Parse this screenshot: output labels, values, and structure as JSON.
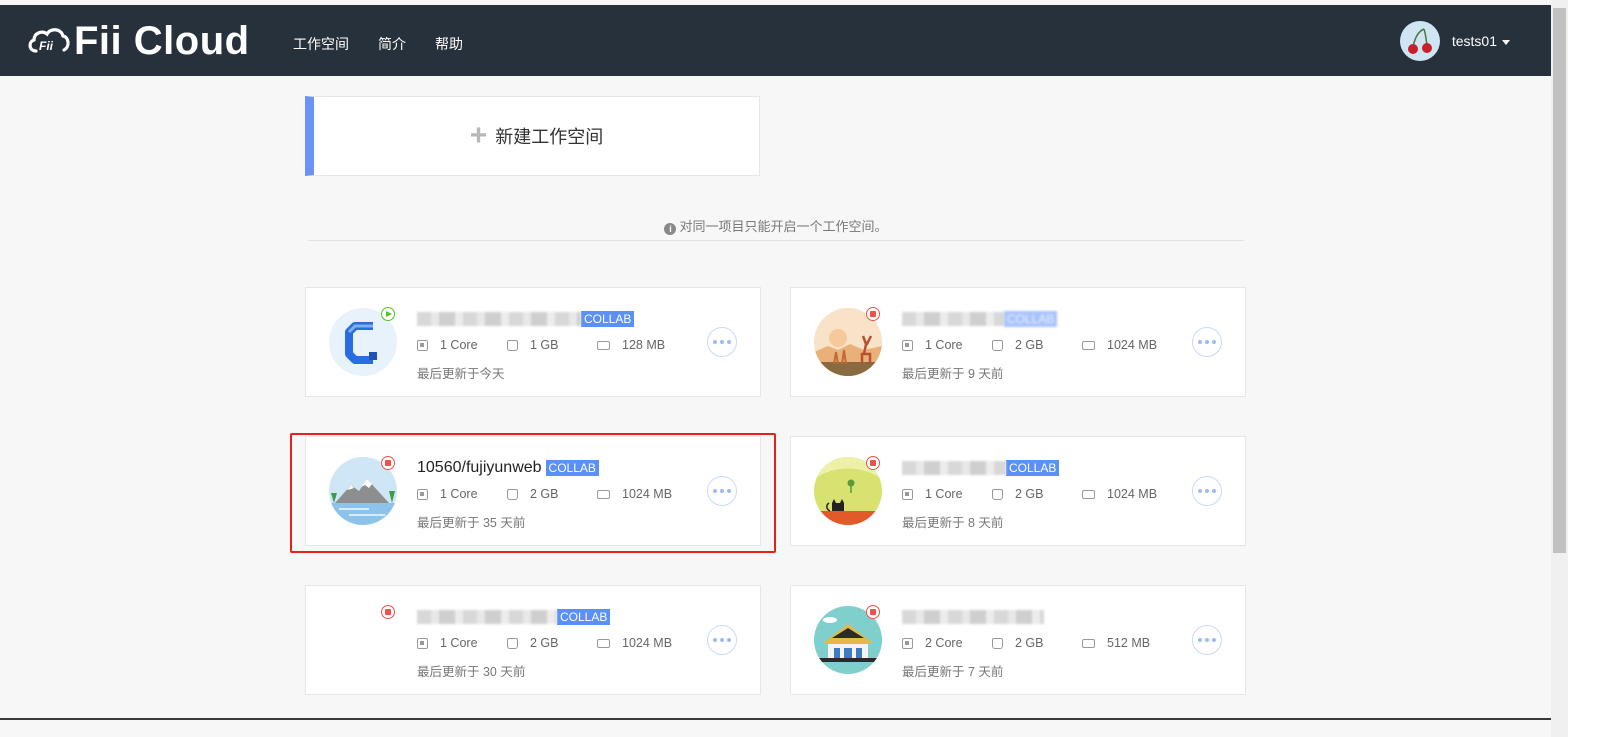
{
  "app": {
    "name": "Fii Cloud"
  },
  "nav": {
    "items": [
      "工作空间",
      "简介",
      "帮助"
    ]
  },
  "user": {
    "name": "tests01"
  },
  "new_workspace": {
    "label": "新建工作空间"
  },
  "notice": {
    "text": "对同一项目只能开启一个工作空间。"
  },
  "colors": {
    "accent": "#5b8ff9",
    "topbar": "#27313b",
    "running": "#52c41a",
    "stopped": "#f0504a",
    "highlight": "#e8201a"
  },
  "workspaces": [
    {
      "title": "",
      "tag": "COLLAB",
      "status": "running",
      "status_icon": "play-icon",
      "cpu": "1 Core",
      "disk": "1 GB",
      "ram": "128 MB",
      "updated": "最后更新于今天"
    },
    {
      "title": "",
      "tag": "COLLAB",
      "status": "stopped",
      "status_icon": "stop-icon",
      "cpu": "1 Core",
      "disk": "2 GB",
      "ram": "1024 MB",
      "updated": "最后更新于 9 天前"
    },
    {
      "title": "10560/fujiyunweb",
      "tag": "COLLAB",
      "status": "stopped",
      "status_icon": "stop-icon",
      "cpu": "1 Core",
      "disk": "2 GB",
      "ram": "1024 MB",
      "updated": "最后更新于 35 天前"
    },
    {
      "title": "",
      "tag": "COLLAB",
      "status": "stopped",
      "status_icon": "stop-icon",
      "cpu": "1 Core",
      "disk": "2 GB",
      "ram": "1024 MB",
      "updated": "最后更新于 8 天前"
    },
    {
      "title": "",
      "tag": "COLLAB",
      "status": "stopped",
      "status_icon": "stop-icon",
      "cpu": "1 Core",
      "disk": "2 GB",
      "ram": "1024 MB",
      "updated": "最后更新于 30 天前"
    },
    {
      "title": "",
      "tag": "",
      "status": "stopped",
      "status_icon": "stop-icon",
      "cpu": "2 Core",
      "disk": "2 GB",
      "ram": "512 MB",
      "updated": "最后更新于 7 天前"
    }
  ]
}
